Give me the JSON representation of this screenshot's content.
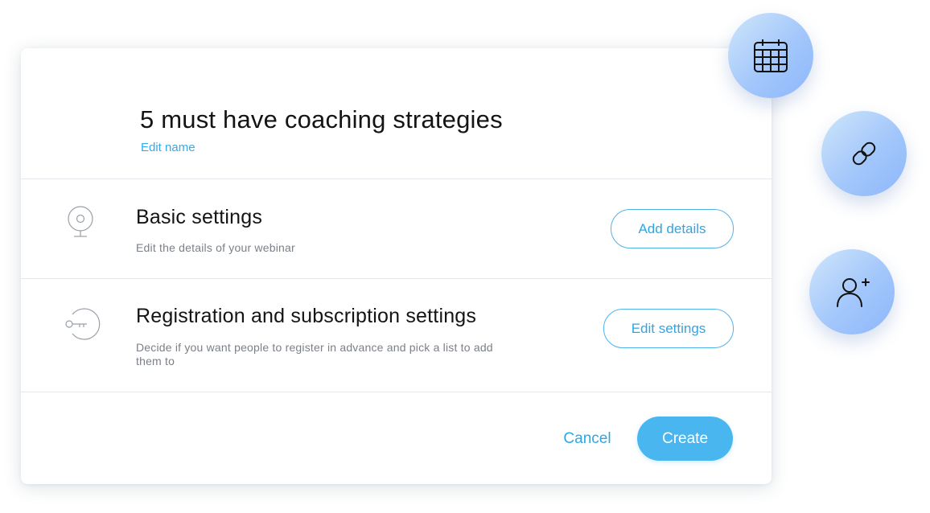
{
  "dialog": {
    "title": "5 must have coaching strategies",
    "edit_name_label": "Edit name",
    "sections": [
      {
        "icon": "webcam-icon",
        "title": "Basic settings",
        "description": "Edit the details of your webinar",
        "button_label": "Add details"
      },
      {
        "icon": "key-icon",
        "title": "Registration and subscription settings",
        "description": "Decide if you want people to register in advance and pick a list to add them to",
        "button_label": "Edit settings"
      }
    ],
    "footer": {
      "cancel_label": "Cancel",
      "create_label": "Create"
    }
  },
  "floating_actions": [
    {
      "icon": "calendar-icon"
    },
    {
      "icon": "link-icon"
    },
    {
      "icon": "add-user-icon"
    }
  ],
  "colors": {
    "accent": "#36a9e6",
    "create_button": "#4ab6f0",
    "title_text": "#141414",
    "muted_text": "#7b8088",
    "divider": "#e3e6ea",
    "float_gradient_start": "#cfe6fb",
    "float_gradient_end": "#8db7fb"
  }
}
